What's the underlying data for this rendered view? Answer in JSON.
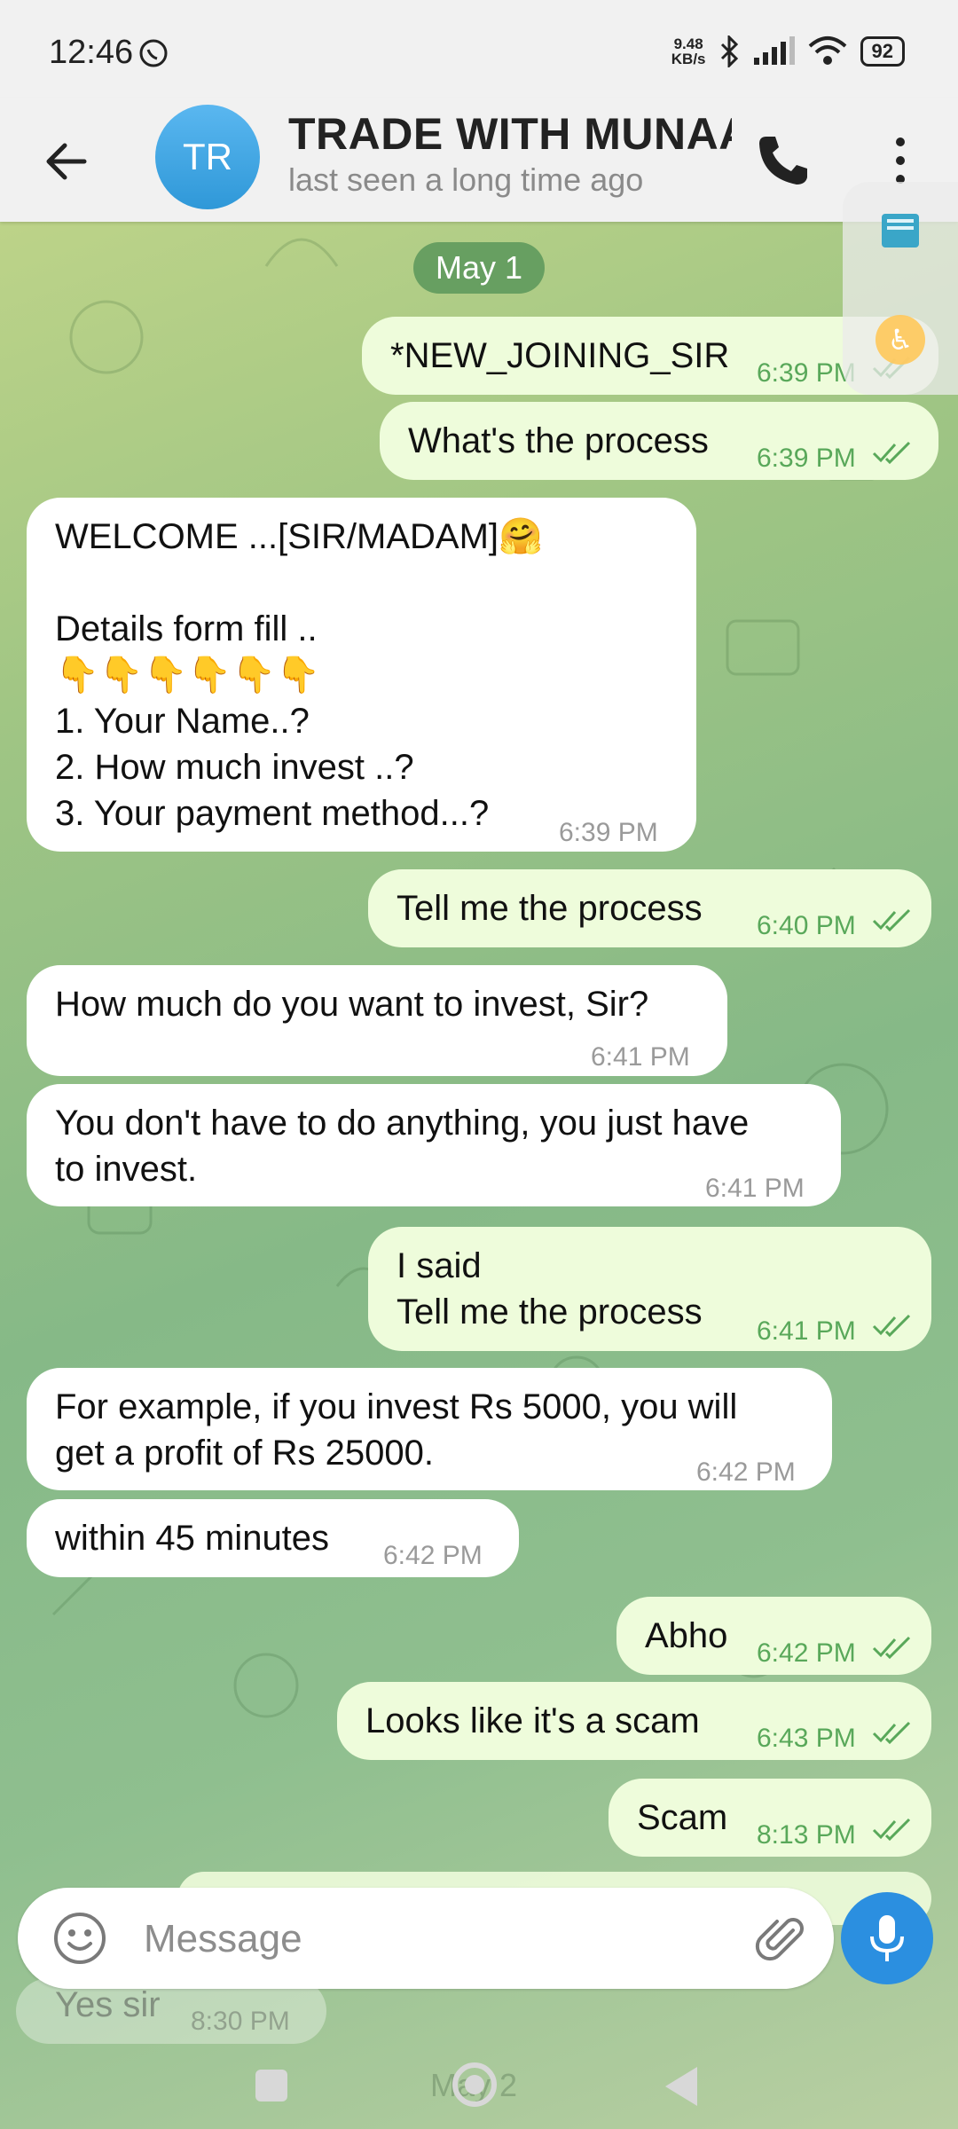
{
  "status": {
    "time": "12:46",
    "net_speed_value": "9.48",
    "net_speed_unit": "KB/s",
    "battery": "92"
  },
  "header": {
    "avatar_initials": "TR",
    "title": "TRADE WITH MUNAAF",
    "subtitle": "last seen a long time ago"
  },
  "date_chip": "May 1",
  "messages": [
    {
      "dir": "out",
      "text": "*NEW_JOINING_SIR",
      "time": "6:39 PM"
    },
    {
      "dir": "out",
      "text": "What's the process",
      "time": "6:39 PM"
    },
    {
      "dir": "in",
      "text": "WELCOME ...[SIR/MADAM]🤗\n\nDetails form fill ..\n👇👇👇👇👇👇\n1.  Your Name..?\n2.  How much invest ..?\n3.  Your payment method...?",
      "time": "6:39 PM"
    },
    {
      "dir": "out",
      "text": "Tell me the process",
      "time": "6:40 PM"
    },
    {
      "dir": "in",
      "text": "How much do you want to invest, Sir?",
      "time": "6:41 PM"
    },
    {
      "dir": "in",
      "text": "You don't have to do anything, you just have\nto invest.",
      "time": "6:41 PM"
    },
    {
      "dir": "out",
      "text": "I said\nTell me the process",
      "time": "6:41 PM"
    },
    {
      "dir": "in",
      "text": "For example, if you invest Rs 5000, you will\nget a profit of Rs 25000.",
      "time": "6:42 PM"
    },
    {
      "dir": "in",
      "text": "within 45 minutes",
      "time": "6:42 PM"
    },
    {
      "dir": "out",
      "text": "Abho",
      "time": "6:42 PM"
    },
    {
      "dir": "out",
      "text": "Looks like it's a scam",
      "time": "6:43 PM"
    },
    {
      "dir": "out",
      "text": "Scam",
      "time": "8:13 PM"
    }
  ],
  "faded": {
    "text": "Yes sir",
    "time": "8:30 PM",
    "date": "May 2"
  },
  "composer": {
    "placeholder": "Message"
  },
  "colors": {
    "outgoing_bubble": "#eefcdb",
    "incoming_bubble": "#ffffff",
    "accent": "#2b8fe0",
    "tick_green": "#59a85a"
  }
}
